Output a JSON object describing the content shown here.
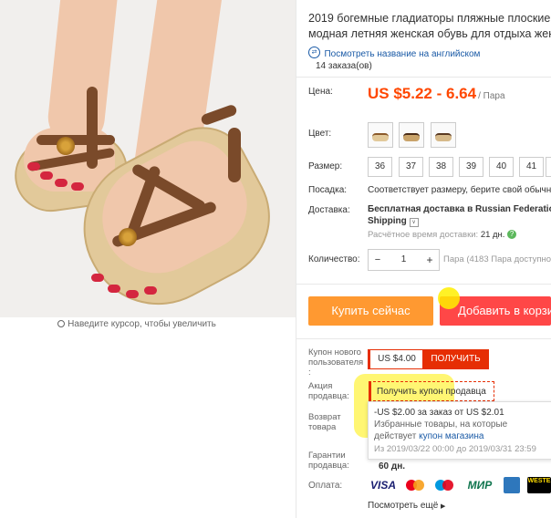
{
  "colors": {
    "accent": "#ff4700",
    "buy": "#ff9931",
    "cart": "#ff4747",
    "coupon": "#e62e04",
    "link": "#1a5aa6",
    "highlight": "#fff200"
  },
  "image": {
    "zoom_hint": "Наведите курсор, чтобы увеличить",
    "zoom_icon": "magnifier-icon"
  },
  "product": {
    "title_line1": "2019 богемные гладиаторы пляжные плоские по",
    "title_line2": "модная летняя женская обувь для отдыха женски",
    "translate_link": "Посмотреть название на английском",
    "orders": "14 заказа(ов)"
  },
  "price": {
    "label": "Цена:",
    "value": "US $5.22 - 6.64",
    "unit": "/ Пара"
  },
  "color": {
    "label": "Цвет:",
    "swatches": [
      "beige-sandal",
      "brown-sandal",
      "dark-brown-sandal"
    ]
  },
  "size": {
    "label": "Размер:",
    "options": [
      "36",
      "37",
      "38",
      "39",
      "40",
      "41",
      ""
    ]
  },
  "fit": {
    "label": "Посадка:",
    "value": "Соответствует размеру, берите свой обычный"
  },
  "delivery": {
    "label": "Доставка:",
    "line1": "Бесплатная доставка в Russian Federation c",
    "line2": "Shipping",
    "time_label": "Расчётное время доставки:",
    "time_value": "21 дн."
  },
  "quantity": {
    "label": "Количество:",
    "minus": "−",
    "value": "1",
    "plus": "+",
    "available": "Пара (4183 Пара доступно)"
  },
  "actions": {
    "buy_now": "Купить сейчас",
    "add_to_cart": "Добавить в корзи"
  },
  "new_user_coupon": {
    "label_line1": "Купон нового",
    "label_line2": "пользователя",
    "label_line3": ":",
    "value": "US $4.00",
    "button": "ПОЛУЧИТЬ"
  },
  "seller_promo": {
    "label_line1": "Акция",
    "label_line2": "продавца:",
    "dropdown": "Получить купон продавца",
    "popup_line1": "-US $2.00 за заказ от US $2.01",
    "popup_line2": "Избранные товары, на которые",
    "popup_line3_a": "действует ",
    "popup_line3_b": "купон магазина",
    "popup_line4": "Из 2019/03/22 00:00 до 2019/03/31 23:59"
  },
  "returns": {
    "label_line1": "Возврат",
    "label_line2": "товара"
  },
  "guarantee": {
    "label_line1": "Гарантии",
    "label_line2": "продавца:",
    "value": "60 дн."
  },
  "payment": {
    "label": "Оплата:",
    "methods": [
      "VISA",
      "",
      "",
      "",
      "МИР",
      "",
      "WESTE"
    ],
    "see_more": "Посмотреть ещё"
  }
}
